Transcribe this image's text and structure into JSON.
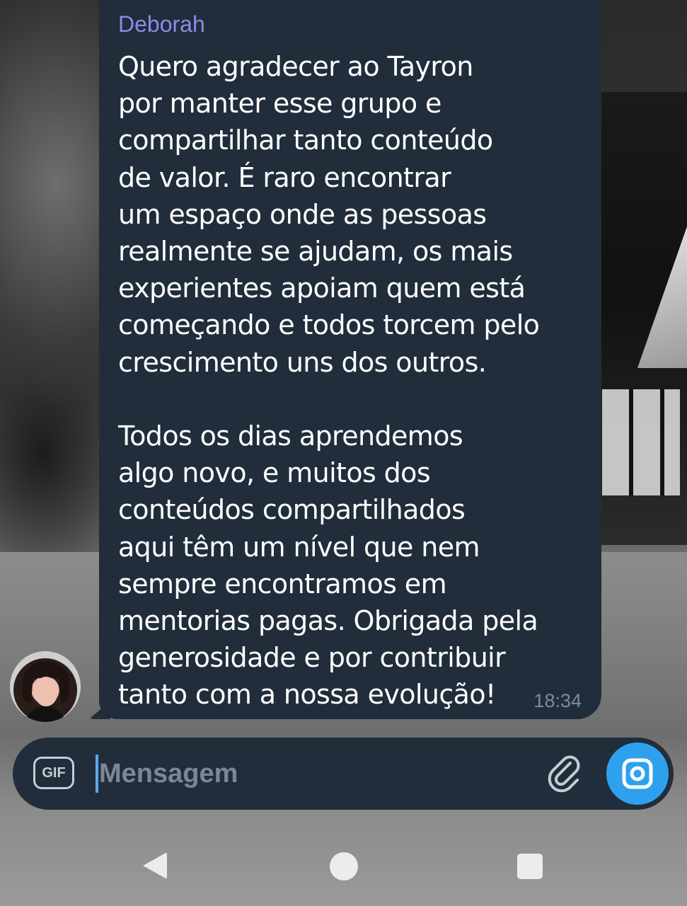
{
  "message": {
    "sender": "Deborah",
    "text": "Quero agradecer ao Tayron\npor manter esse grupo e\ncompartilhar tanto conteúdo\nde valor. É raro encontrar\num espaço onde as pessoas\nrealmente se ajudam, os mais\nexperientes apoiam quem está\ncomeçando e todos torcem pelo\ncrescimento uns dos outros.\n\nTodos os dias aprendemos\nalgo novo, e muitos dos\nconteúdos compartilhados\naqui têm um nível que nem\nsempre encontramos em\nmentorias pagas. Obrigada pela\ngenerosidade e por contribuir\ntanto com a nossa evolução!",
    "time": "18:34"
  },
  "composer": {
    "gif_label": "GIF",
    "placeholder": "Mensagem",
    "value": "",
    "attach_icon": "paperclip-icon",
    "camera_icon": "camera-icon"
  },
  "colors": {
    "bubble_bg": "#212d3b",
    "sender_name": "#8f8ae8",
    "accent": "#2ea1ee",
    "time_text": "#7f8b99"
  },
  "nav": {
    "back_icon": "back-triangle-icon",
    "home_icon": "home-circle-icon",
    "recents_icon": "recents-square-icon"
  }
}
